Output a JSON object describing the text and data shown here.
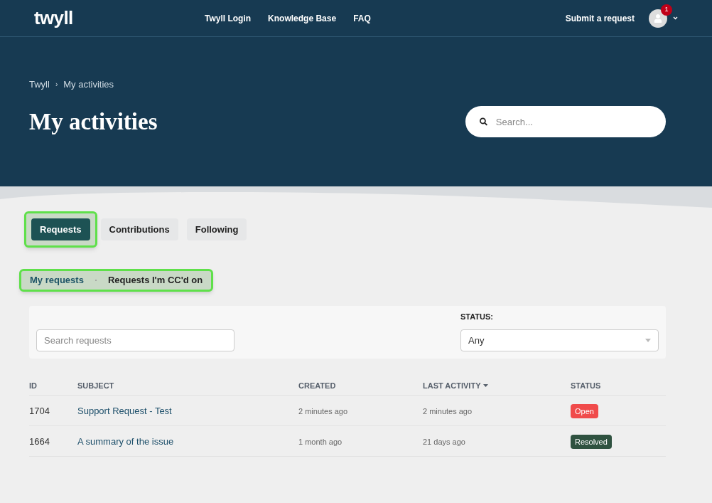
{
  "header": {
    "logo": "twyll",
    "nav": [
      "Twyll Login",
      "Knowledge Base",
      "FAQ"
    ],
    "submit": "Submit a request",
    "notifications": "1"
  },
  "hero": {
    "breadcrumbs": [
      "Twyll",
      "My activities"
    ],
    "separator": "›",
    "title": "My activities",
    "search": {
      "placeholder": "Search..."
    }
  },
  "tabs": [
    {
      "label": "Requests",
      "selected": true,
      "highlighted": true
    },
    {
      "label": "Contributions",
      "selected": false,
      "highlighted": false
    },
    {
      "label": "Following",
      "selected": false,
      "highlighted": false
    }
  ],
  "subtabs": {
    "highlighted": true,
    "items": [
      {
        "label": "My requests",
        "selected": true
      },
      {
        "label": "Requests I'm CC'd on",
        "selected": false
      }
    ]
  },
  "filters": {
    "search": {
      "placeholder": "Search requests"
    },
    "status_label": "STATUS:",
    "status_value": "Any"
  },
  "table": {
    "columns": [
      {
        "label": "ID",
        "sorted": false
      },
      {
        "label": "SUBJECT",
        "sorted": false
      },
      {
        "label": "CREATED",
        "sorted": false
      },
      {
        "label": "LAST ACTIVITY",
        "sorted": true
      },
      {
        "label": "STATUS",
        "sorted": false
      }
    ],
    "rows": [
      {
        "id": "1704",
        "subject": "Support Request - Test",
        "created": "2 minutes ago",
        "last_activity": "2 minutes ago",
        "status": "Open",
        "color": "#f04b4b"
      },
      {
        "id": "1664",
        "subject": "A summary of the issue",
        "created": "1 month ago",
        "last_activity": "21 days ago",
        "status": "Resolved",
        "color": "#2f5240"
      }
    ]
  }
}
